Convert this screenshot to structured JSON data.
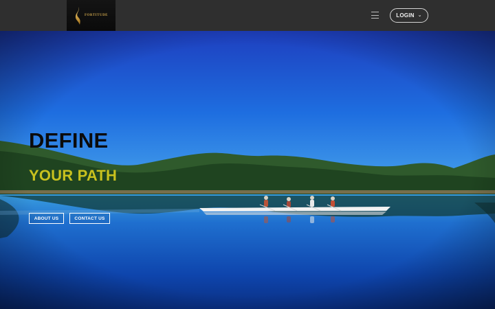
{
  "header": {
    "brand": "FORTITUDE",
    "login_label": "LOGIN",
    "menu_icon": "hamburger-icon",
    "dropdown_icon": "chevron-down-icon"
  },
  "hero": {
    "headline_line1": "DEFINE",
    "headline_line2": "YOUR PATH",
    "buttons": {
      "about": "ABOUT US",
      "contact": "CONTACT US"
    }
  },
  "colors": {
    "topbar": "#2f2f2f",
    "accent_yellow": "#c8c11e",
    "logo_gold": "#c9a24a",
    "sky": "#1456c8",
    "water": "#0a3fa6"
  }
}
